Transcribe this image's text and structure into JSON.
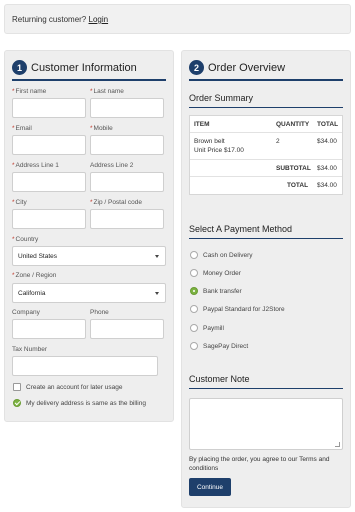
{
  "returning": {
    "prefix": "Returning customer?",
    "link": "Login"
  },
  "customer": {
    "step": "1",
    "title": "Customer Information",
    "first_name": {
      "label": "First name",
      "required": "*",
      "value": ""
    },
    "last_name": {
      "label": "Last name",
      "required": "*",
      "value": ""
    },
    "email": {
      "label": "Email",
      "required": "*",
      "value": ""
    },
    "mobile": {
      "label": "Mobile",
      "required": "*",
      "value": ""
    },
    "address1": {
      "label": "Address Line 1",
      "required": "*",
      "value": ""
    },
    "address2": {
      "label": "Address Line 2",
      "value": ""
    },
    "city": {
      "label": "City",
      "required": "*",
      "value": ""
    },
    "zip": {
      "label": "Zip / Postal code",
      "required": "*",
      "value": ""
    },
    "country": {
      "label": "Country",
      "required": "*",
      "value": "United States"
    },
    "zone": {
      "label": "Zone / Region",
      "required": "*",
      "value": "California"
    },
    "company": {
      "label": "Company",
      "value": ""
    },
    "phone": {
      "label": "Phone",
      "value": ""
    },
    "tax": {
      "label": "Tax Number",
      "value": ""
    },
    "create_account": "Create an account for later usage",
    "same_billing": "My delivery address is same as the billing"
  },
  "order": {
    "step": "2",
    "title": "Order Overview",
    "summary_title": "Order Summary",
    "table": {
      "headers": {
        "item": "ITEM",
        "quantity": "QUANTITY",
        "total": "TOTAL"
      },
      "item_name": "Brown belt",
      "item_price": "Unit Price $17.00",
      "item_qty": "2",
      "item_total": "$34.00",
      "subtotal_label": "SUBTOTAL",
      "subtotal": "$34.00",
      "total_label": "TOTAL",
      "total": "$34.00"
    },
    "payment_title": "Select A Payment Method",
    "payments": [
      "Cash on Delivery",
      "Money Order",
      "Bank transfer",
      "Paypal Standard for J2Store",
      "Paymill",
      "SagePay Direct"
    ],
    "selected_payment": "Bank transfer",
    "note_title": "Customer Note",
    "note_value": "",
    "terms": "By placing the order, you agree to our Terms and conditions",
    "continue": "Continue"
  },
  "colors": {
    "accent": "#1e3f6b",
    "check": "#7cb342",
    "required": "#c0392b"
  }
}
